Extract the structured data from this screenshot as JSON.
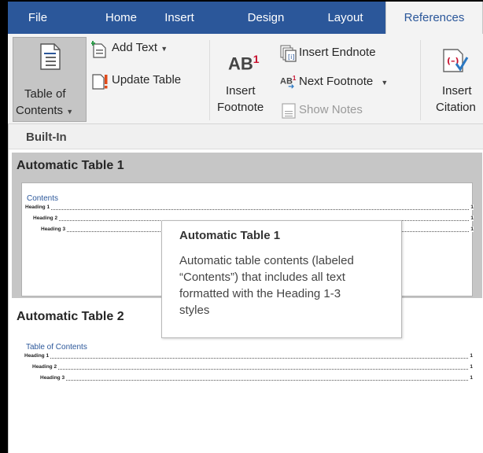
{
  "tabs": [
    {
      "label": "File"
    },
    {
      "label": "Home"
    },
    {
      "label": "Insert"
    },
    {
      "label": "Design"
    },
    {
      "label": "Layout"
    },
    {
      "label": "References",
      "active": true
    }
  ],
  "ribbon": {
    "toc": {
      "line1": "Table of",
      "line2": "Contents",
      "icon": "table-of-contents-icon"
    },
    "add_text": {
      "label": "Add Text",
      "icon": "add-text-icon"
    },
    "update_table": {
      "label": "Update Table",
      "icon": "update-table-icon"
    },
    "insert_footnote": {
      "icon_text": "AB",
      "superscript": "1",
      "line1": "Insert",
      "line2": "Footnote"
    },
    "insert_endnote": {
      "label": "Insert Endnote",
      "icon": "insert-endnote-icon"
    },
    "next_footnote": {
      "label": "Next Footnote",
      "icon": "next-footnote-icon"
    },
    "show_notes": {
      "label": "Show Notes",
      "icon": "show-notes-icon",
      "disabled": true
    },
    "insert_citation": {
      "line1": "Insert",
      "line2": "Citation",
      "icon": "insert-citation-icon"
    }
  },
  "gallery": {
    "section_header": "Built-In",
    "items": [
      {
        "title": "Automatic Table 1",
        "preview_title": "Contents",
        "rows": [
          {
            "text": "Heading 1",
            "num": "1"
          },
          {
            "text": "Heading 2",
            "num": "1"
          },
          {
            "text": "Heading 3",
            "num": "1"
          }
        ]
      },
      {
        "title": "Automatic Table 2",
        "preview_title": "Table of Contents",
        "rows": [
          {
            "text": "Heading 1",
            "num": "1"
          },
          {
            "text": "Heading 2",
            "num": "1"
          },
          {
            "text": "Heading 3",
            "num": "1"
          }
        ]
      }
    ]
  },
  "tooltip": {
    "title": "Automatic Table 1",
    "lines": [
      "Automatic table contents (labeled",
      "“Contents”) that includes all text",
      "formatted with the Heading 1-3",
      "styles"
    ]
  },
  "colors": {
    "tab_bar": "#2b579a",
    "ribbon_bg": "#f3f3f3",
    "selected_item": "#c6c6c6",
    "preview_heading": "#2b579a",
    "footnote_red": "#c8102e",
    "citation_blue": "#2b78c2"
  }
}
